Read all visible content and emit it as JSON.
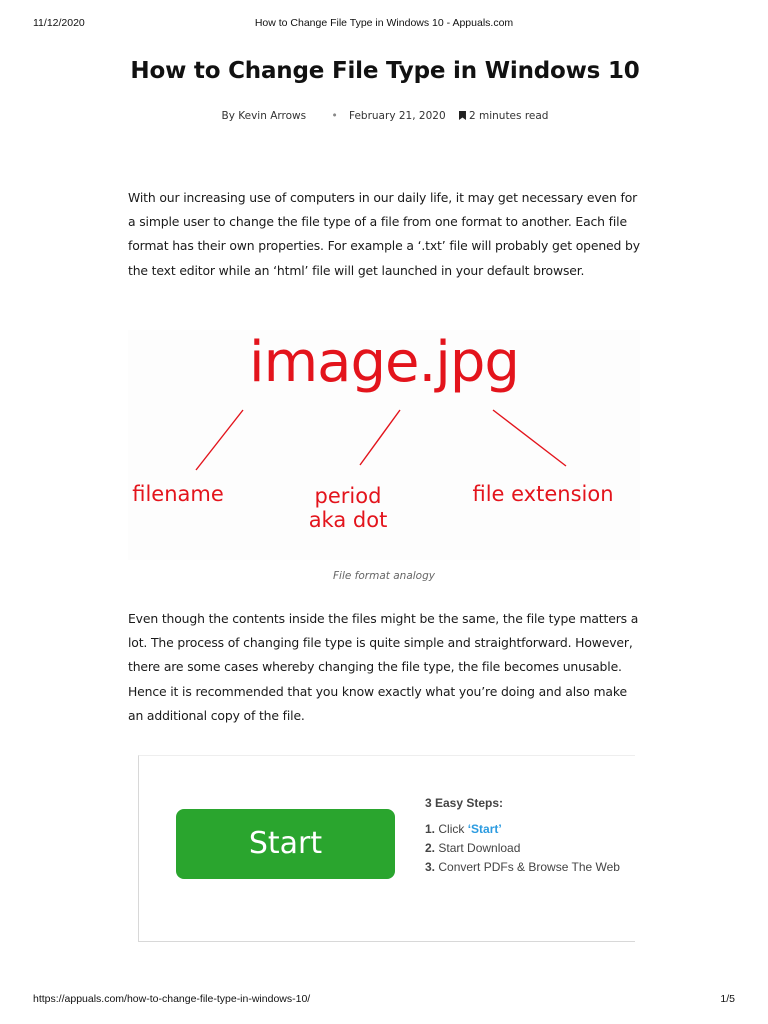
{
  "print_header": {
    "date": "11/12/2020",
    "page_title": "How to Change File Type in Windows 10 - Appuals.com"
  },
  "article": {
    "title": "How to Change File Type in Windows 10",
    "author": "By Kevin Arrows",
    "date": "February 21, 2020",
    "read_time": "2 minutes read",
    "paragraphs": [
      "With our increasing use of computers in our daily life, it may get necessary even for a simple user to change the file type of a file from one format to another. Each file format has their own properties. For example a ‘.txt’ file will probably get opened by the text editor while an ‘html’ file will get launched in your default browser.",
      "Even though the contents inside the files might be the same, the file type matters a lot. The process of changing file type is quite simple and straightforward. However, there are some cases whereby changing the file type, the file becomes unusable. Hence it is recommended that you know exactly what you’re doing and also make an additional copy of the file."
    ],
    "figure": {
      "word": "image.jpg",
      "label_filename": "filename",
      "label_period_1": "period",
      "label_period_2": "aka dot",
      "label_extension": "file extension",
      "caption": "File format analogy",
      "color": "#e3141c"
    }
  },
  "ad": {
    "button_label": "Start",
    "button_color": "#2aa52e",
    "steps_title": "3 Easy Steps:",
    "steps": [
      {
        "num": "1.",
        "text": "Click ",
        "highlight": "‘Start’"
      },
      {
        "num": "2.",
        "text": "Start Download",
        "highlight": ""
      },
      {
        "num": "3.",
        "text": "Convert PDFs & Browse The Web",
        "highlight": ""
      }
    ],
    "highlight_color": "#2b9be0"
  },
  "print_footer": {
    "url": "https://appuals.com/how-to-change-file-type-in-windows-10/",
    "page": "1/5"
  }
}
